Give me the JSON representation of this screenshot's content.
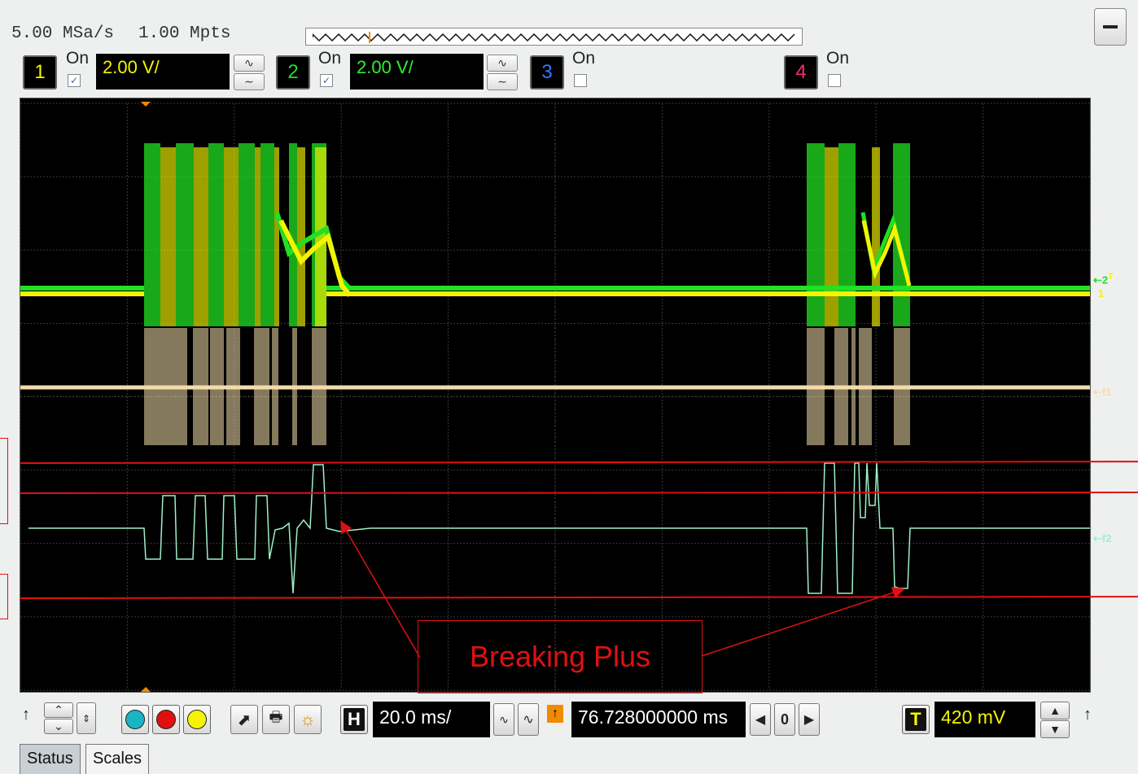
{
  "header": {
    "sample_rate": "5.00 MSa/s",
    "memory_depth": "1.00 Mpts"
  },
  "channels": [
    {
      "number": "1",
      "on_label": "On",
      "checked": true,
      "scale": "2.00 V/",
      "color": "#f4f400"
    },
    {
      "number": "2",
      "on_label": "On",
      "checked": true,
      "scale": "2.00 V/",
      "color": "#22e022"
    },
    {
      "number": "3",
      "on_label": "On",
      "checked": false,
      "color": "#2f7bff"
    },
    {
      "number": "4",
      "on_label": "On",
      "checked": false,
      "color": "#ff2a6a"
    }
  ],
  "markers": {
    "ch_upper": "2",
    "ch_upper_sup": "T",
    "ch_lower": "1",
    "f1": "f1",
    "f2": "f2"
  },
  "annotation": {
    "text": "Breaking Plus",
    "color": "#e01010"
  },
  "toolbar": {
    "horizontal_label": "H",
    "time_per_div": "20.0 ms/",
    "delay": "76.728000000 ms",
    "nav_value": "0",
    "trigger_label": "T",
    "trigger_level": "420 mV",
    "trigger_color": "#f4f400"
  },
  "tabs": [
    "Status",
    "Scales"
  ],
  "icons": {
    "minimize": "minimize-icon",
    "run": "run-control-icon",
    "stop": "stop-control-icon",
    "single": "single-control-icon"
  },
  "colors": {
    "ch1": "#f4f400",
    "ch2": "#22e022",
    "f1": "#f3dcaa",
    "f2": "#9ef0c6",
    "run": "#19b5c4",
    "stop": "#e01010",
    "single": "#f4f400"
  }
}
